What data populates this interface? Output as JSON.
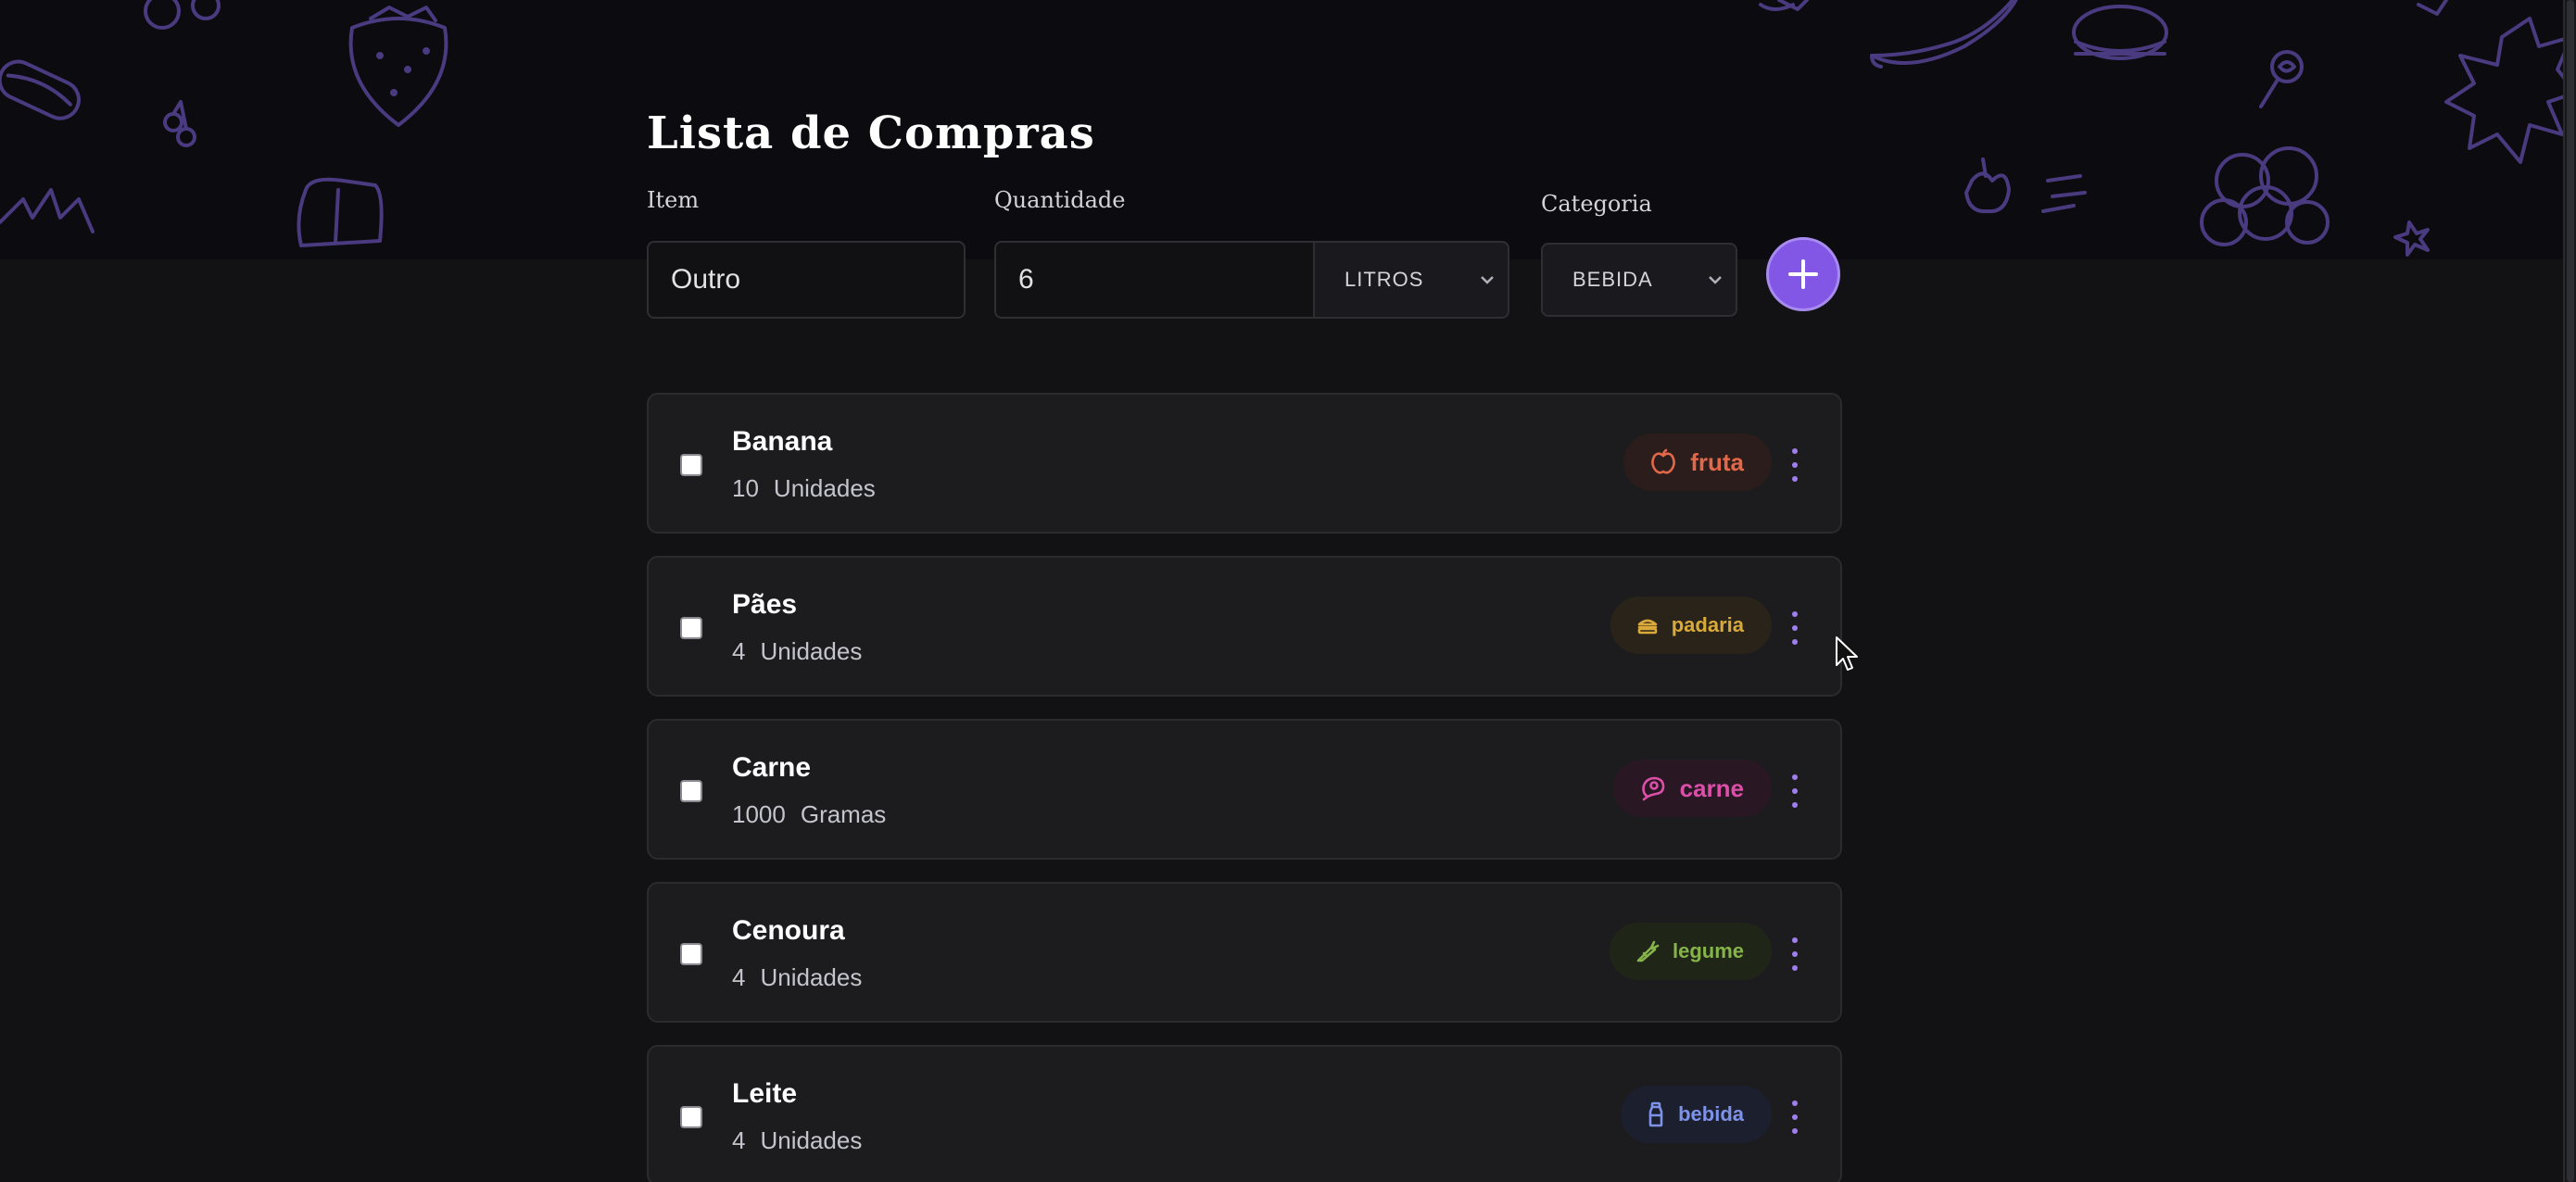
{
  "header": {
    "title": "Lista de Compras"
  },
  "form": {
    "item_label": "Item",
    "item_value": "Outro",
    "quantity_label": "Quantidade",
    "quantity_value": "6",
    "unit_selected": "LITROS",
    "category_label": "Categoria",
    "category_selected": "BEBIDA",
    "add_icon": "plus-icon"
  },
  "items": [
    {
      "name": "Banana",
      "amount": "10",
      "unit": "Unidades",
      "category": "fruta",
      "icon": "apple-icon",
      "color": "#e2684a",
      "bg": "#2b1d1b"
    },
    {
      "name": "Pães",
      "amount": "4",
      "unit": "Unidades",
      "category": "padaria",
      "icon": "sandwich-icon",
      "color": "#d9a93a",
      "bg": "#29231a"
    },
    {
      "name": "Carne",
      "amount": "1000",
      "unit": "Gramas",
      "category": "carne",
      "icon": "beef-icon",
      "color": "#db4fa8",
      "bg": "#2a1724"
    },
    {
      "name": "Cenoura",
      "amount": "4",
      "unit": "Unidades",
      "category": "legume",
      "icon": "carrot-icon",
      "color": "#86b34a",
      "bg": "#1f2618"
    },
    {
      "name": "Leite",
      "amount": "4",
      "unit": "Unidades",
      "category": "bebida",
      "icon": "milk-icon",
      "color": "#7d92e8",
      "bg": "#1c1f2e"
    }
  ],
  "colors": {
    "background": "#121214",
    "accent": "#8257e5",
    "card": "#1c1c1f"
  }
}
